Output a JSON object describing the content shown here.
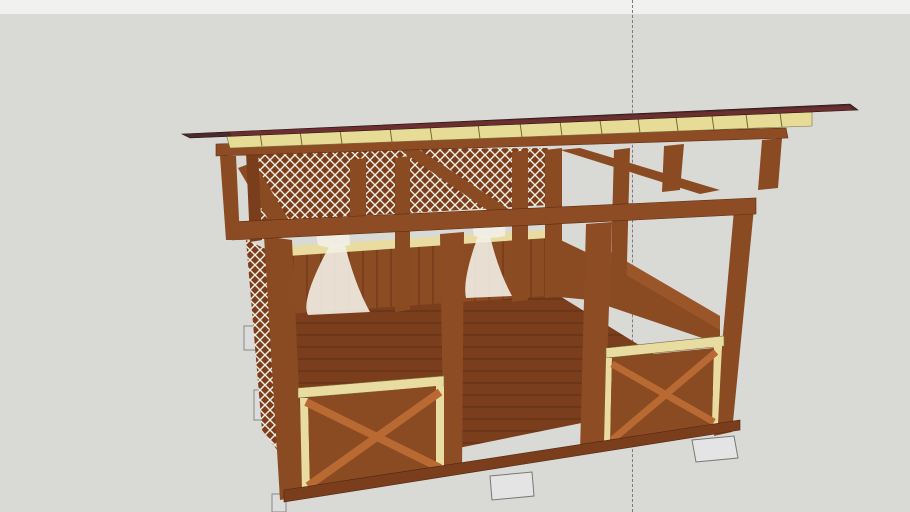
{
  "scene": {
    "subject": "gazebo-3d-model",
    "colors": {
      "background": "#d9dad6",
      "wood": "#8a4a22",
      "wood_dark": "#6b3618",
      "wood_light": "#a0602e",
      "trim": "#e8dca0",
      "roof": "#5a2a2a",
      "footing": "#e0e0e0",
      "lattice": "#f3eee0",
      "curtain": "#f2eee6"
    }
  }
}
